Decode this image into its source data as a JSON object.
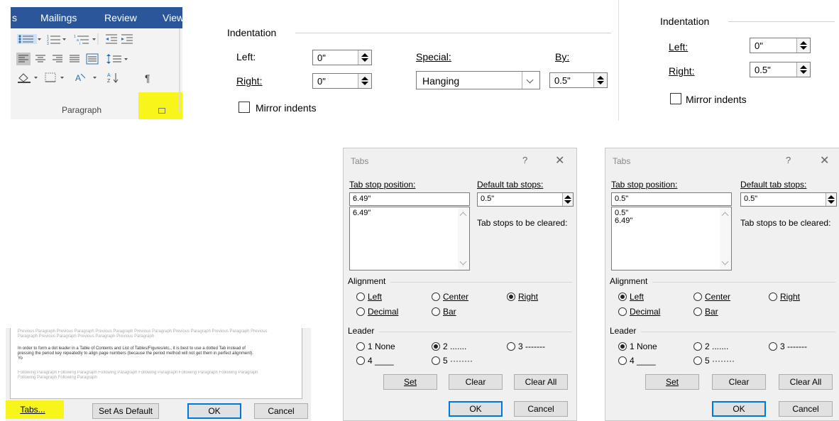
{
  "ribbon": {
    "tabs": [
      "Mailings",
      "Review",
      "View"
    ],
    "group_label": "Paragraph",
    "highlight_color": "#f7f51a",
    "tab_bar_color": "#2b579a"
  },
  "indent_panel_1": {
    "title": "Indentation",
    "left_label": "Left:",
    "left_value": "0\"",
    "right_label": "Right:",
    "right_value": "0\"",
    "special_label": "Special:",
    "special_value": "Hanging",
    "by_label": "By:",
    "by_value": "0.5\"",
    "mirror_label": "Mirror indents"
  },
  "indent_panel_2": {
    "title": "Indentation",
    "left_label": "Left:",
    "left_value": "0\"",
    "right_label": "Right:",
    "right_value": "0.5\"",
    "mirror_label": "Mirror indents"
  },
  "tabs_dialog_1": {
    "title": "Tabs",
    "help": "?",
    "close": "✕",
    "tab_stop_label": "Tab stop position:",
    "tab_stop_value": "6.49\"",
    "tab_stop_list": [
      "6.49\""
    ],
    "default_label": "Default tab stops:",
    "default_value": "0.5\"",
    "cleared_label": "Tab stops to be cleared:",
    "alignment_label": "Alignment",
    "align_left": "Left",
    "align_center": "Center",
    "align_right": "Right",
    "align_decimal": "Decimal",
    "align_bar": "Bar",
    "selected_alignment": "Right",
    "leader_label": "Leader",
    "leader_1": "1 None",
    "leader_2": "2 .......",
    "leader_3": "3 -------",
    "leader_4": "4 ____",
    "leader_5": "5 ········",
    "selected_leader": "2",
    "set_label": "Set",
    "clear_label": "Clear",
    "clear_all_label": "Clear All",
    "ok_label": "OK",
    "cancel_label": "Cancel"
  },
  "tabs_dialog_2": {
    "title": "Tabs",
    "help": "?",
    "close": "✕",
    "tab_stop_label": "Tab stop position:",
    "tab_stop_value": "0.5\"",
    "tab_stop_list": [
      "0.5\"",
      "6.49\""
    ],
    "default_label": "Default tab stops:",
    "default_value": "0.5\"",
    "cleared_label": "Tab stops to be cleared:",
    "alignment_label": "Alignment",
    "align_left": "Left",
    "align_center": "Center",
    "align_right": "Right",
    "align_decimal": "Decimal",
    "align_bar": "Bar",
    "selected_alignment": "Left",
    "leader_label": "Leader",
    "leader_1": "1 None",
    "leader_2": "2 .......",
    "leader_3": "3 -------",
    "leader_4": "4 ____",
    "leader_5": "5 ········",
    "selected_leader": "1",
    "set_label": "Set",
    "clear_label": "Clear",
    "clear_all_label": "Clear All",
    "ok_label": "OK",
    "cancel_label": "Cancel"
  },
  "paragraph_dialog": {
    "preview_prev": "Previous Paragraph Previous Paragraph Previous Paragraph Previous Paragraph Previous Paragraph Previous Paragraph Previous Paragraph Previous Paragraph Previous Paragraph Previous Paragraph",
    "preview_text": "In order to form a dot leader in a Table of Contents and List of Tables/Figures/etc., it is best to use a dotted Tab instead of pressing the period key repeatedly to align page numbers (because the period method will not get them in perfect alignment). Yo",
    "preview_next": "Following Paragraph Following Paragraph Following Paragraph Following Paragraph Following Paragraph Following Paragraph Following Paragraph Following Paragraph",
    "tabs_label": "Tabs...",
    "set_default_label": "Set As Default",
    "ok_label": "OK",
    "cancel_label": "Cancel"
  }
}
